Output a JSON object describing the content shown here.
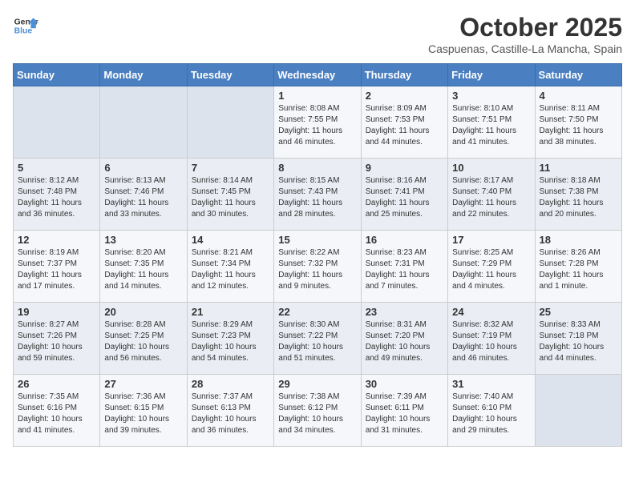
{
  "header": {
    "logo_line1": "General",
    "logo_line2": "Blue",
    "month": "October 2025",
    "location": "Caspuenas, Castille-La Mancha, Spain"
  },
  "weekdays": [
    "Sunday",
    "Monday",
    "Tuesday",
    "Wednesday",
    "Thursday",
    "Friday",
    "Saturday"
  ],
  "weeks": [
    [
      {
        "day": "",
        "info": ""
      },
      {
        "day": "",
        "info": ""
      },
      {
        "day": "",
        "info": ""
      },
      {
        "day": "1",
        "info": "Sunrise: 8:08 AM\nSunset: 7:55 PM\nDaylight: 11 hours and 46 minutes."
      },
      {
        "day": "2",
        "info": "Sunrise: 8:09 AM\nSunset: 7:53 PM\nDaylight: 11 hours and 44 minutes."
      },
      {
        "day": "3",
        "info": "Sunrise: 8:10 AM\nSunset: 7:51 PM\nDaylight: 11 hours and 41 minutes."
      },
      {
        "day": "4",
        "info": "Sunrise: 8:11 AM\nSunset: 7:50 PM\nDaylight: 11 hours and 38 minutes."
      }
    ],
    [
      {
        "day": "5",
        "info": "Sunrise: 8:12 AM\nSunset: 7:48 PM\nDaylight: 11 hours and 36 minutes."
      },
      {
        "day": "6",
        "info": "Sunrise: 8:13 AM\nSunset: 7:46 PM\nDaylight: 11 hours and 33 minutes."
      },
      {
        "day": "7",
        "info": "Sunrise: 8:14 AM\nSunset: 7:45 PM\nDaylight: 11 hours and 30 minutes."
      },
      {
        "day": "8",
        "info": "Sunrise: 8:15 AM\nSunset: 7:43 PM\nDaylight: 11 hours and 28 minutes."
      },
      {
        "day": "9",
        "info": "Sunrise: 8:16 AM\nSunset: 7:41 PM\nDaylight: 11 hours and 25 minutes."
      },
      {
        "day": "10",
        "info": "Sunrise: 8:17 AM\nSunset: 7:40 PM\nDaylight: 11 hours and 22 minutes."
      },
      {
        "day": "11",
        "info": "Sunrise: 8:18 AM\nSunset: 7:38 PM\nDaylight: 11 hours and 20 minutes."
      }
    ],
    [
      {
        "day": "12",
        "info": "Sunrise: 8:19 AM\nSunset: 7:37 PM\nDaylight: 11 hours and 17 minutes."
      },
      {
        "day": "13",
        "info": "Sunrise: 8:20 AM\nSunset: 7:35 PM\nDaylight: 11 hours and 14 minutes."
      },
      {
        "day": "14",
        "info": "Sunrise: 8:21 AM\nSunset: 7:34 PM\nDaylight: 11 hours and 12 minutes."
      },
      {
        "day": "15",
        "info": "Sunrise: 8:22 AM\nSunset: 7:32 PM\nDaylight: 11 hours and 9 minutes."
      },
      {
        "day": "16",
        "info": "Sunrise: 8:23 AM\nSunset: 7:31 PM\nDaylight: 11 hours and 7 minutes."
      },
      {
        "day": "17",
        "info": "Sunrise: 8:25 AM\nSunset: 7:29 PM\nDaylight: 11 hours and 4 minutes."
      },
      {
        "day": "18",
        "info": "Sunrise: 8:26 AM\nSunset: 7:28 PM\nDaylight: 11 hours and 1 minute."
      }
    ],
    [
      {
        "day": "19",
        "info": "Sunrise: 8:27 AM\nSunset: 7:26 PM\nDaylight: 10 hours and 59 minutes."
      },
      {
        "day": "20",
        "info": "Sunrise: 8:28 AM\nSunset: 7:25 PM\nDaylight: 10 hours and 56 minutes."
      },
      {
        "day": "21",
        "info": "Sunrise: 8:29 AM\nSunset: 7:23 PM\nDaylight: 10 hours and 54 minutes."
      },
      {
        "day": "22",
        "info": "Sunrise: 8:30 AM\nSunset: 7:22 PM\nDaylight: 10 hours and 51 minutes."
      },
      {
        "day": "23",
        "info": "Sunrise: 8:31 AM\nSunset: 7:20 PM\nDaylight: 10 hours and 49 minutes."
      },
      {
        "day": "24",
        "info": "Sunrise: 8:32 AM\nSunset: 7:19 PM\nDaylight: 10 hours and 46 minutes."
      },
      {
        "day": "25",
        "info": "Sunrise: 8:33 AM\nSunset: 7:18 PM\nDaylight: 10 hours and 44 minutes."
      }
    ],
    [
      {
        "day": "26",
        "info": "Sunrise: 7:35 AM\nSunset: 6:16 PM\nDaylight: 10 hours and 41 minutes."
      },
      {
        "day": "27",
        "info": "Sunrise: 7:36 AM\nSunset: 6:15 PM\nDaylight: 10 hours and 39 minutes."
      },
      {
        "day": "28",
        "info": "Sunrise: 7:37 AM\nSunset: 6:13 PM\nDaylight: 10 hours and 36 minutes."
      },
      {
        "day": "29",
        "info": "Sunrise: 7:38 AM\nSunset: 6:12 PM\nDaylight: 10 hours and 34 minutes."
      },
      {
        "day": "30",
        "info": "Sunrise: 7:39 AM\nSunset: 6:11 PM\nDaylight: 10 hours and 31 minutes."
      },
      {
        "day": "31",
        "info": "Sunrise: 7:40 AM\nSunset: 6:10 PM\nDaylight: 10 hours and 29 minutes."
      },
      {
        "day": "",
        "info": ""
      }
    ]
  ]
}
